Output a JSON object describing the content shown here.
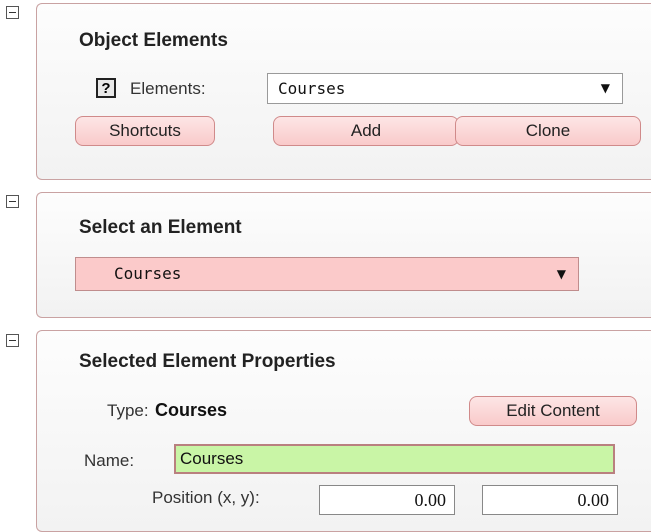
{
  "object_elements": {
    "title": "Object Elements",
    "help_icon_glyph": "?",
    "elements_label": "Elements:",
    "elements_value": "Courses",
    "dropdown_arrow": "▼",
    "shortcuts_label": "Shortcuts",
    "add_label": "Add",
    "clone_label": "Clone"
  },
  "select_element": {
    "title": "Select an Element",
    "value": "Courses",
    "dropdown_arrow": "▼"
  },
  "properties": {
    "title": "Selected Element Properties",
    "type_label": "Type:",
    "type_value": "Courses",
    "edit_content_label": "Edit Content",
    "name_label": "Name:",
    "name_value": "Courses",
    "position_label": "Position (x, y):",
    "position_x": "0.00",
    "position_y": "0.00"
  },
  "colors": {
    "panel_border": "#c9a2a2",
    "button_fill": "#f9caca",
    "select_highlight": "#fbcaca",
    "name_field": "#c9f5a6"
  }
}
